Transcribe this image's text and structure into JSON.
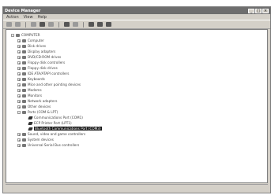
{
  "window": {
    "title": "Device Manager"
  },
  "menu": [
    "Action",
    "View",
    "Help"
  ],
  "toolbar_icons": [
    "back-icon",
    "forward-icon",
    "up-icon",
    "properties-icon",
    "refresh-icon",
    "help-icon",
    "scan-icon",
    "update-driver-icon",
    "uninstall-icon",
    "disable-icon"
  ],
  "tree": [
    {
      "label": "COMPUTER",
      "level": 0,
      "exp": "-"
    },
    {
      "label": "Computer",
      "level": 1,
      "exp": "+"
    },
    {
      "label": "Disk drives",
      "level": 1,
      "exp": "+"
    },
    {
      "label": "Display adapters",
      "level": 1,
      "exp": "+"
    },
    {
      "label": "DVD/CD-ROM drives",
      "level": 1,
      "exp": "+"
    },
    {
      "label": "Floppy disk controllers",
      "level": 1,
      "exp": "+"
    },
    {
      "label": "Floppy disk drives",
      "level": 1,
      "exp": "+"
    },
    {
      "label": "IDE ATA/ATAPI controllers",
      "level": 1,
      "exp": "+"
    },
    {
      "label": "Keyboards",
      "level": 1,
      "exp": "+"
    },
    {
      "label": "Mice and other pointing devices",
      "level": 1,
      "exp": "+"
    },
    {
      "label": "Modems",
      "level": 1,
      "exp": "+"
    },
    {
      "label": "Monitors",
      "level": 1,
      "exp": "+"
    },
    {
      "label": "Network adapters",
      "level": 1,
      "exp": "+"
    },
    {
      "label": "Other devices",
      "level": 1,
      "exp": "+"
    },
    {
      "label": "Ports (COM & LPT)",
      "level": 1,
      "exp": "-"
    },
    {
      "label": "Communications Port (COM1)",
      "level": 2,
      "exp": "",
      "warn": true
    },
    {
      "label": "ECP Printer Port (LPT1)",
      "level": 2,
      "exp": "",
      "warn": true
    },
    {
      "label": "Bluetooth Communications Port (COM3)",
      "level": 2,
      "exp": "",
      "warn": true,
      "selected": true
    },
    {
      "label": "Sound, video and game controllers",
      "level": 1,
      "exp": "+"
    },
    {
      "label": "System devices",
      "level": 1,
      "exp": "+"
    },
    {
      "label": "Universal Serial Bus controllers",
      "level": 1,
      "exp": "+"
    }
  ],
  "status_text": ""
}
